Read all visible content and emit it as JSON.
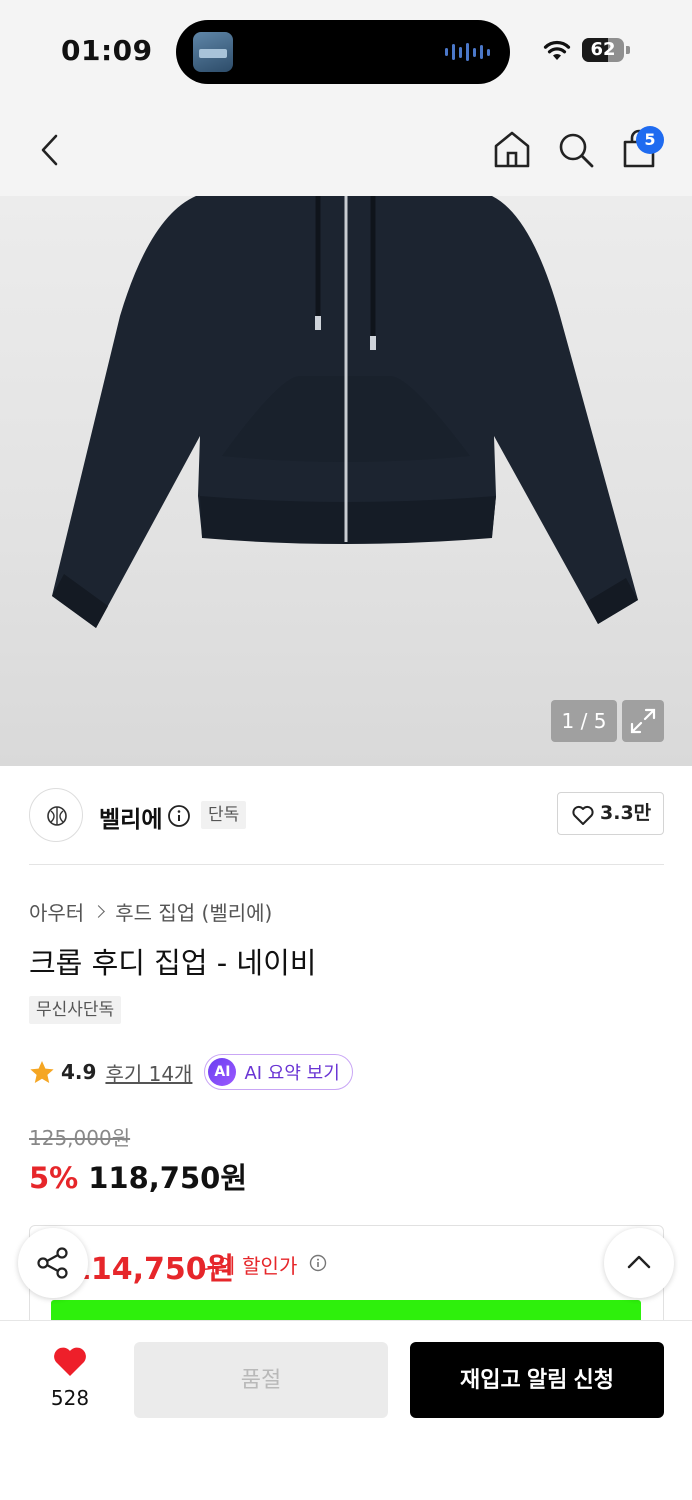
{
  "status_bar": {
    "time": "01:09",
    "battery": "62",
    "battery_level": 0.62
  },
  "header": {
    "cart_count": "5"
  },
  "gallery": {
    "counter": "1 / 5"
  },
  "brand": {
    "name": "벨리에",
    "tag": "단독",
    "likes": "3.3만"
  },
  "product": {
    "breadcrumb": [
      "아우터",
      "후드 집업 (벨리에)"
    ],
    "title": "크롭 후디 집업 - 네이비",
    "tag": "무신사단독",
    "rating": "4.9",
    "reviews": "후기 14개",
    "ai_badge": "AI",
    "ai_summary": "AI 요약 보기",
    "original_price": "125,000원",
    "discount": "5%",
    "sale_price": "118,750원"
  },
  "my_price": {
    "amount": "114,750원",
    "label": "나의 할인가"
  },
  "bottom_bar": {
    "wish_count": "528",
    "soldout_label": "품절",
    "restock_label": "재입고 알림 신청"
  },
  "colors": {
    "accent_red": "#e6262a",
    "badge_blue": "#1f6bf0",
    "ai_purple": "#6a35d4",
    "promo_green": "#2ef00c"
  }
}
